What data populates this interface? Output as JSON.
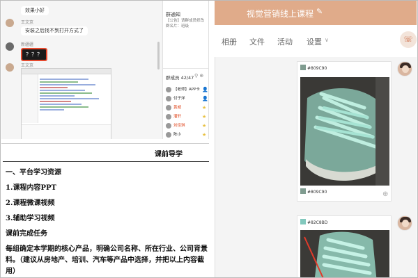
{
  "chat": {
    "messages": [
      {
        "text": "效果小好"
      },
      {
        "user": "王文京",
        "text": "安装之后找不到打开方式了"
      },
      {
        "user": "新疆疆",
        "text": "？？？"
      },
      {
        "user": "王文京"
      }
    ],
    "side": {
      "notice_title": "群通知",
      "notice_text": "【公告】请群成员修改群名片：班级",
      "members_title": "群成员 42/47",
      "members": [
        {
          "name": "【老师】APP卡",
          "color": "#2a2a2a",
          "icon": "person-icon",
          "icon_char": "👤"
        },
        {
          "name": "付子洋",
          "color": "#2a2a2a",
          "icon": "person-icon",
          "icon_char": "👤"
        },
        {
          "name": "黄威",
          "color": "#e0471e",
          "icon": "star-icon",
          "icon_char": "★"
        },
        {
          "name": "潘轩",
          "color": "#e0471e",
          "icon": "star-icon",
          "icon_char": "★"
        },
        {
          "name": "刘佳琪",
          "color": "#e0471e",
          "icon": "star-icon",
          "icon_char": "★"
        },
        {
          "name": "陈小",
          "color": "#2a2a2a",
          "icon": "star-icon",
          "icon_char": "★"
        }
      ]
    }
  },
  "doc": {
    "title": "课前导学",
    "lines": [
      "一、平台学习资源",
      "1.课程内容PPT",
      "2.课程微课视频",
      "3.辅助学习视频",
      "课前完成任务",
      "每组确定本学期的核心产品，明确公司名称、所在行业、公司背景",
      "料。（建议从房地产、培训、汽车等产品中选择，并把以上内容截",
      "用）"
    ]
  },
  "app": {
    "title": "视觉营销线上课程",
    "tabs": [
      "相册",
      "文件",
      "活动",
      "设置"
    ],
    "cards": [
      {
        "swatch_label": "#809C90",
        "swatch_color": "#809C90",
        "caption": "#809C90"
      },
      {
        "swatch_label": "#82C8BD",
        "swatch_color": "#82C8BD"
      }
    ],
    "colors": {
      "header": "#E0AB8A",
      "accent": "#C8623A"
    }
  }
}
